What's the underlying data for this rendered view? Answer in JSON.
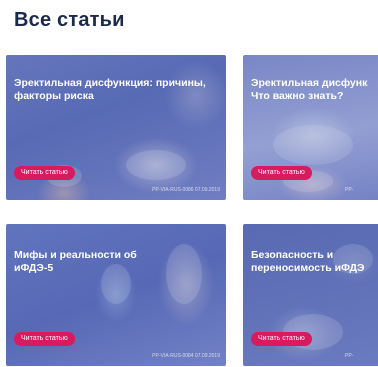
{
  "page": {
    "title": "Все статьи"
  },
  "articles": [
    {
      "title": "Эректильная дисфункция: причины, факторы риска",
      "button_label": "Читать статью",
      "code": "PP-VIA-RUS-0086  07.09.2019"
    },
    {
      "title_line1": "Эректильная дисфунк",
      "title_line2": "Что важно знать?",
      "button_label": "Читать статью",
      "code": "PP-"
    },
    {
      "title_line1": "Мифы и реальности об",
      "title_line2": "иФДЭ-5",
      "button_label": "Читать статью",
      "code": "PP-VIA-RUS-0084  07.09.2019"
    },
    {
      "title_line1": "Безопасность и",
      "title_line2": "переносимость иФДЭ",
      "button_label": "Читать статью",
      "code": "PP-"
    }
  ],
  "colors": {
    "title": "#1a2a4a",
    "button": "#d81b5f",
    "overlay": "#5d6fb8"
  }
}
